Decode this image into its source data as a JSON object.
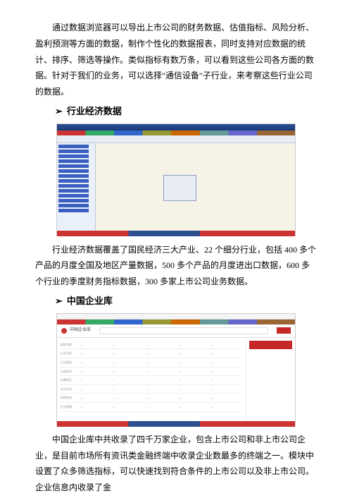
{
  "paragraphs": {
    "intro": "通过数据浏览器可以导出上市公司的财务数据、估值指标、风险分析、盈利预测等方面的数据，制作个性化的数据报表，同时支持对应数据的统计、排序、筛选等操作。类似指标有数万条，可以看到这些公司各方面的数据。针对于我们的业务，可以选择\"通信设备\"子行业，来考察这些行业公司的数据。",
    "industry_data": "行业经济数据覆盖了国民经济三大产业、22 个细分行业，包括 400 多个产品的月度全国及地区产量数据，500 多个产品的月度进出口数据，600 多个行业的季度财务指标数据，300 多家上市公司业务数据。",
    "enterprise_db": "中国企业库中共收录了四千万家企业，包含上市公司和非上市公司企业，是目前市场所有资讯类金融终端中收录企业数最多的终端之一。模块中设置了众多筛选指标，可以快速找到符合条件的上市公司以及非上市公司。企业信息内收录了金"
  },
  "headings": {
    "h1": "行业经济数据",
    "h2": "中国企业库"
  },
  "arrow_glyph": "➢",
  "stub2": {
    "title": "中国企业库",
    "filters": {
      "r1l": "搜索名称",
      "r2l": "行业分类",
      "r3l": "企业类型",
      "r4l": "注册资本",
      "r5l": "所属地区",
      "r6l": "成立年份",
      "r7l": "经营状态",
      "r8l": "企业规模"
    }
  }
}
